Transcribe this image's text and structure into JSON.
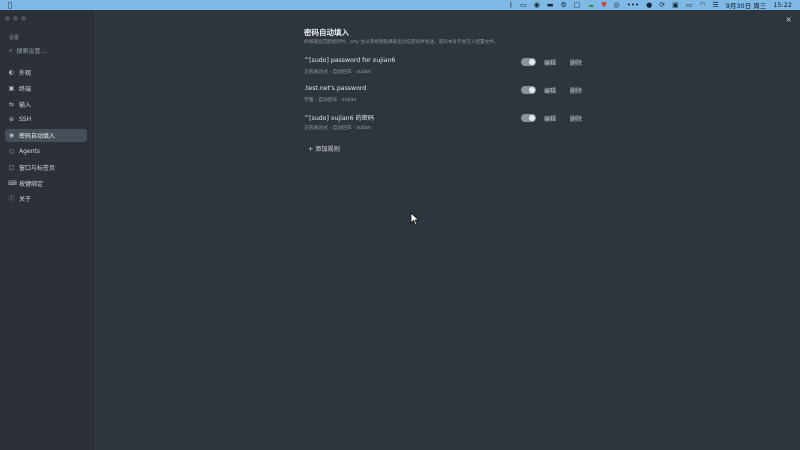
{
  "menubar": {
    "datetime": "9月30日 周三",
    "time": "15:22",
    "icons": [
      "apple-icon",
      "bluetooth-icon",
      "screen-mirror-icon",
      "camera-icon",
      "chat-icon",
      "settings-icon",
      "box-icon",
      "cloud-icon",
      "shield-icon",
      "compass-icon",
      "more-icon",
      "wechat-icon",
      "sync-icon",
      "terminal-icon",
      "battery-icon",
      "wifi-icon",
      "control-center-icon"
    ]
  },
  "sidebar": {
    "heading": "设置",
    "search_placeholder": "搜索设置...",
    "items": [
      {
        "label": "外观",
        "icon": "appearance-icon"
      },
      {
        "label": "终端",
        "icon": "terminal-icon"
      },
      {
        "label": "输入",
        "icon": "input-icon"
      },
      {
        "label": "SSH",
        "icon": "link-icon"
      },
      {
        "label": "密码自动填入",
        "icon": "eye-icon"
      },
      {
        "label": "Agents",
        "icon": "agents-icon"
      },
      {
        "label": "窗口与标签页",
        "icon": "window-icon"
      },
      {
        "label": "按键绑定",
        "icon": "keyboard-icon"
      },
      {
        "label": "关于",
        "icon": "info-icon"
      }
    ]
  },
  "main": {
    "title": "密码自动填入",
    "description": "终端输出匹配规则时，etty 会从系统钥匙串取出对应密码并发送。密码本身不会写入配置文件。",
    "rules": [
      {
        "name": "^[sudo] password for xujian6",
        "meta": "正则表达式 · 自动回车 · xujian",
        "edit": "编辑",
        "delete": "删除"
      },
      {
        "name": ".test.net's password",
        "meta": "字面 · 自动回车 · xujian",
        "edit": "编辑",
        "delete": "删除"
      },
      {
        "name": "^[sudo] xujian6 的密码",
        "meta": "正则表达式 · 自动回车 · xujian",
        "edit": "编辑",
        "delete": "删除"
      }
    ],
    "add_rule": "+ 添加规则",
    "close": "×"
  }
}
